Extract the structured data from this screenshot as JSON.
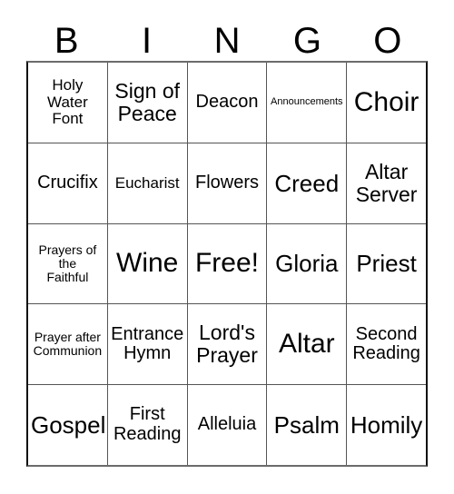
{
  "card": {
    "title": "BINGO",
    "header_letters": [
      "B",
      "I",
      "N",
      "G",
      "O"
    ],
    "free_space_label": "Free!",
    "colors": {
      "background": "#ffffff",
      "text": "#000000",
      "grid_line": "#555555",
      "outer_border": "#111111"
    },
    "rows": [
      [
        {
          "label": "Holy\nWater\nFont",
          "size": "sm"
        },
        {
          "label": "Sign of\nPeace",
          "size": "lg"
        },
        {
          "label": "Deacon",
          "size": "md"
        },
        {
          "label": "Announcements",
          "size": "xxs"
        },
        {
          "label": "Choir",
          "size": "xxl"
        }
      ],
      [
        {
          "label": "Crucifix",
          "size": "md"
        },
        {
          "label": "Eucharist",
          "size": "sm"
        },
        {
          "label": "Flowers",
          "size": "md"
        },
        {
          "label": "Creed",
          "size": "xl"
        },
        {
          "label": "Altar\nServer",
          "size": "lg"
        }
      ],
      [
        {
          "label": "Prayers of\nthe\nFaithful",
          "size": "xs"
        },
        {
          "label": "Wine",
          "size": "xxl"
        },
        {
          "label": "Free!",
          "size": "xxl"
        },
        {
          "label": "Gloria",
          "size": "xl"
        },
        {
          "label": "Priest",
          "size": "xl"
        }
      ],
      [
        {
          "label": "Prayer after\nCommunion",
          "size": "xs"
        },
        {
          "label": "Entrance\nHymn",
          "size": "md"
        },
        {
          "label": "Lord's\nPrayer",
          "size": "lg"
        },
        {
          "label": "Altar",
          "size": "xxl"
        },
        {
          "label": "Second\nReading",
          "size": "md"
        }
      ],
      [
        {
          "label": "Gospel",
          "size": "xl"
        },
        {
          "label": "First\nReading",
          "size": "md"
        },
        {
          "label": "Alleluia",
          "size": "md"
        },
        {
          "label": "Psalm",
          "size": "xl"
        },
        {
          "label": "Homily",
          "size": "xl"
        }
      ]
    ]
  }
}
